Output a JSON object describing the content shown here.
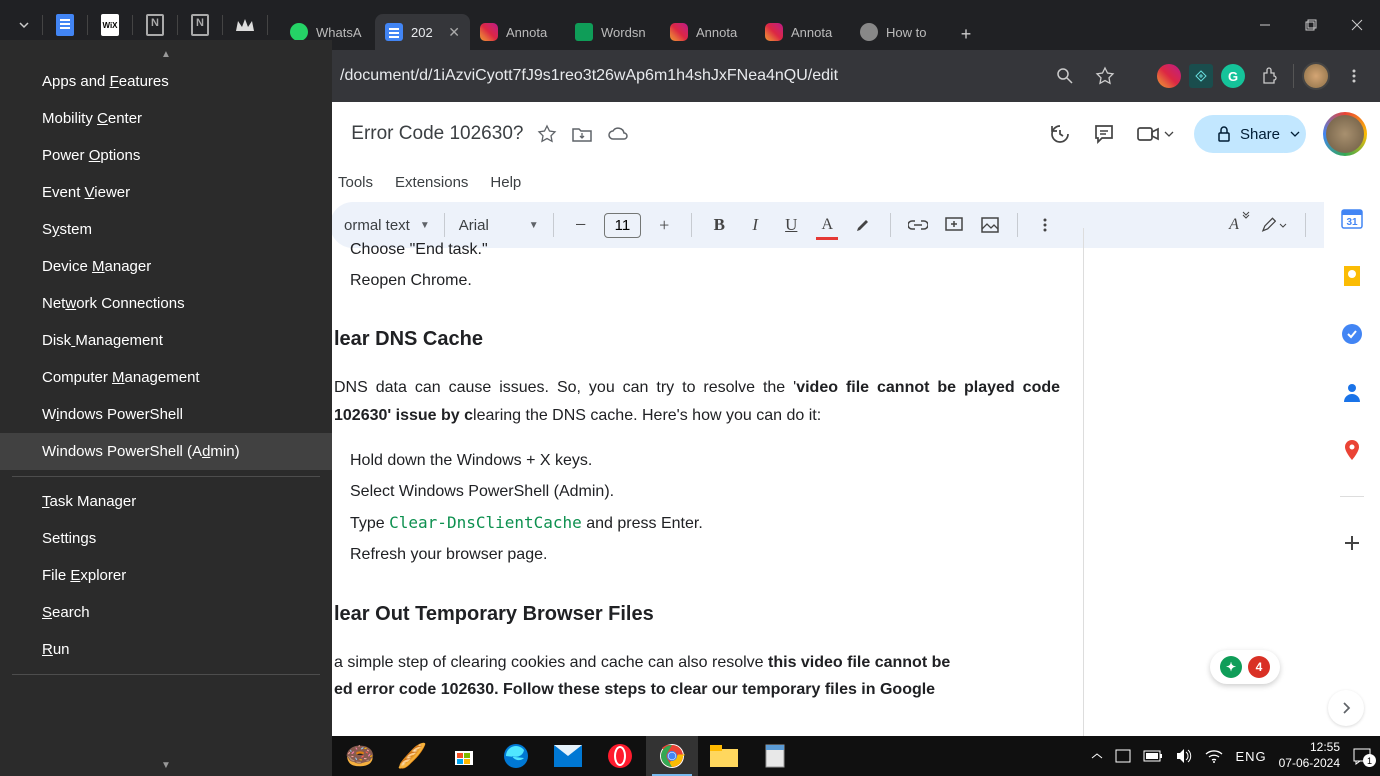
{
  "titlebar": {
    "tabs": [
      {
        "title": "WhatsA",
        "icon": "whatsapp"
      },
      {
        "title": "202",
        "icon": "docs",
        "active": true
      },
      {
        "title": "Annota",
        "icon": "instagram"
      },
      {
        "title": "Wordsn",
        "icon": "sheets"
      },
      {
        "title": "Annota",
        "icon": "instagram"
      },
      {
        "title": "Annota",
        "icon": "instagram"
      },
      {
        "title": "How to",
        "icon": "globe"
      }
    ]
  },
  "addressbar": {
    "url": "/document/d/1iAzviCyott7fJ9s1reo3t26wAp6m1h4shJxFNea4nQU/edit"
  },
  "docs": {
    "title_fragment": "‎ Error Code 102630?",
    "menus": [
      "Tools",
      "Extensions",
      "Help"
    ],
    "share_label": "Share",
    "toolbar": {
      "style": "ormal text",
      "font": "Arial",
      "size": "11"
    }
  },
  "content": {
    "li1": "Choose \"End task.\"",
    "li2": "Reopen Chrome.",
    "h1": "lear DNS Cache",
    "p1a": "DNS data can cause issues. So, you can try to resolve the '",
    "p1b": "video file cannot be played",
    "p1c": " code 102630' issue by c",
    "p1d": "learing the DNS cache. Here's how you can do it:",
    "s1": "Hold down the Windows + X keys.",
    "s2": "Select Windows PowerShell (Admin).",
    "s3a": "Type ",
    "s3b": "Clear-DnsClientCache",
    "s3c": " and press Enter.",
    "s4": "Refresh your browser page.",
    "h2": "lear Out Temporary Browser Files",
    "p2a": " a simple step of clearing cookies and cache can also resolve ",
    "p2b": "this video file cannot be",
    "p2c": "ed error code 102630. Follow these steps to clear our temporary files in Google"
  },
  "explore_badge": "4",
  "winx": {
    "items": [
      {
        "label": "Apps and Features",
        "underline_idx": 9
      },
      {
        "label": "Mobility Center",
        "underline_idx": 9
      },
      {
        "label": "Power Options",
        "underline_idx": 6
      },
      {
        "label": "Event Viewer",
        "underline_idx": 6
      },
      {
        "label": "System",
        "underline_idx": 1
      },
      {
        "label": "Device Manager",
        "underline_idx": 7
      },
      {
        "label": "Network Connections",
        "underline_idx": 3
      },
      {
        "label": "Disk Management",
        "underline_idx": 4
      },
      {
        "label": "Computer Management",
        "underline_idx": 9
      },
      {
        "label": "Windows PowerShell",
        "underline_idx": 1
      },
      {
        "label": "Windows PowerShell (Admin)",
        "underline_idx": 21,
        "highlighted": true
      },
      {
        "separator": true
      },
      {
        "label": "Task Manager",
        "underline_idx": 0
      },
      {
        "label": "Settings",
        "underline_idx": 6
      },
      {
        "label": "File Explorer",
        "underline_idx": 5
      },
      {
        "label": "Search",
        "underline_idx": 0
      },
      {
        "label": "Run",
        "underline_idx": 0
      },
      {
        "separator": true
      }
    ]
  },
  "taskbar": {
    "lang": "ENG",
    "time": "12:55",
    "date": "07-06-2024",
    "notif_count": "1"
  }
}
